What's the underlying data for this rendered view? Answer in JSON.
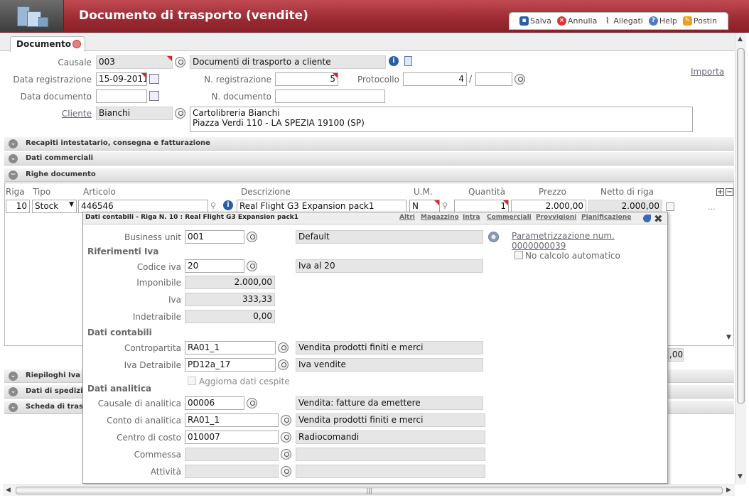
{
  "window": {
    "title": "Documento di trasporto (vendite)"
  },
  "toolbar": {
    "salva": "Salva",
    "annulla": "Annulla",
    "allegati": "Allegati",
    "help": "Help",
    "postin": "Postin"
  },
  "tab": {
    "label": "Documento"
  },
  "form": {
    "causale_label": "Causale",
    "causale_code": "003",
    "causale_desc": "Documenti di trasporto a cliente",
    "data_reg_label": "Data registrazione",
    "data_reg": "15-09-2011",
    "n_reg_label": "N. registrazione",
    "n_reg": "5",
    "protocollo_label": "Protocollo",
    "protocollo": "4",
    "protocollo_sep": "/",
    "protocollo_suffix": "",
    "importa_link": "Importa",
    "data_doc_label": "Data documento",
    "data_doc": "",
    "n_doc_label": "N. documento",
    "n_doc": "",
    "cliente_label": "Cliente",
    "cliente": "Bianchi",
    "cliente_addr1": "Cartolibreria Bianchi",
    "cliente_addr2": "Piazza Verdi 110 - LA SPEZIA 19100 (SP)"
  },
  "sections": {
    "recapiti": "Recapiti intestatario, consegna e fatturazione",
    "commerciali": "Dati commerciali",
    "righe": "Righe documento",
    "riepiloghi": "Riepiloghi Iva e",
    "spedizione": "Dati di spedizior",
    "scheda": "Scheda di traspo"
  },
  "grid": {
    "headers": [
      "Riga",
      "Tipo",
      "Articolo",
      "Descrizione",
      "U.M.",
      "Quantità",
      "Prezzo",
      "Netto di riga"
    ],
    "row": {
      "riga": "10",
      "tipo": "Stock",
      "articolo": "446546",
      "descrizione": "Real Flight G3 Expansion pack1",
      "um": "N",
      "quantita": "1",
      "prezzo": "2.000,00",
      "netto": "2.000,00",
      "dots": "..."
    },
    "total_partial": ",00"
  },
  "popup": {
    "title": "Dati contabili - Riga N. 10 : Real Flight G3 Expansion pack1",
    "links": [
      "Altri",
      "Magazzino",
      "Intra",
      "Commerciali",
      "Provvigioni",
      "Pianificazione"
    ],
    "business_unit_label": "Business unit",
    "business_unit": "001",
    "business_unit_desc": "Default",
    "param_link": "Parametrizzazione num. 0000000039",
    "no_calcolo": "No calcolo automatico",
    "rif_iva_header": "Riferimenti Iva",
    "codice_iva_label": "Codice iva",
    "codice_iva": "20",
    "codice_iva_desc": "Iva al 20",
    "imponibile_label": "Imponibile",
    "imponibile": "2.000,00",
    "iva_label": "Iva",
    "iva": "333,33",
    "indetraibile_label": "Indetraibile",
    "indetraibile": "0,00",
    "dati_contabili_header": "Dati contabili",
    "contropartita_label": "Contropartita",
    "contropartita": "RA01_1",
    "contropartita_desc": "Vendita prodotti finiti e merci",
    "iva_detraibile_label": "Iva Detraibile",
    "iva_detraibile": "PD12a_17",
    "iva_detraibile_desc": "Iva vendite",
    "aggiorna_cespite": "Aggiorna dati cespite",
    "dati_analitica_header": "Dati analitica",
    "causale_analitica_label": "Causale di analitica",
    "causale_analitica": "00006",
    "causale_analitica_desc": "Vendita: fatture da emettere",
    "conto_analitica_label": "Conto di analitica",
    "conto_analitica": "RA01_1",
    "conto_analitica_desc": "Vendita prodotti finiti e merci",
    "centro_costo_label": "Centro di costo",
    "centro_costo": "010007",
    "centro_costo_desc": "Radiocomandi",
    "commessa_label": "Commessa",
    "attivita_label": "Attività"
  },
  "colors": {
    "title_bar": "#a8323a",
    "accent_red": "#d22222"
  }
}
